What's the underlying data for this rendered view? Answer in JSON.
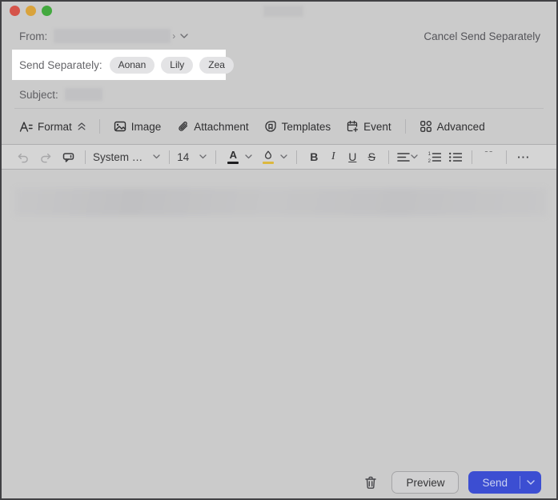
{
  "window": {
    "traffic_lights": [
      "close",
      "minimize",
      "zoom"
    ]
  },
  "header": {
    "cancel_link": "Cancel Send Separately"
  },
  "from_row": {
    "label": "From:",
    "suffix": "›"
  },
  "send_separately": {
    "label": "Send Separately:",
    "chips": [
      "Aonan",
      "Lily",
      "Zea"
    ]
  },
  "subject_row": {
    "label": "Subject:"
  },
  "format_toolbar": {
    "format": "Format",
    "image": "Image",
    "attachment": "Attachment",
    "templates": "Templates",
    "event": "Event",
    "advanced": "Advanced"
  },
  "text_toolbar": {
    "font_family": "System …",
    "font_size": "14",
    "text_color_glyph": "A",
    "bold": "B",
    "italic": "I",
    "underline": "U",
    "strikethrough": "S",
    "quote_icon": "“",
    "more_icon": "···"
  },
  "footer": {
    "preview": "Preview",
    "send": "Send"
  },
  "colors": {
    "send_button": "#3c4ed2",
    "highlight_bar": "#dcb83f",
    "spotlight_background": "#ffffff",
    "window_background": "#cbcbcb",
    "traffic_red": "#d5544a",
    "traffic_yellow": "#d9a33c",
    "traffic_green": "#43a93f"
  }
}
